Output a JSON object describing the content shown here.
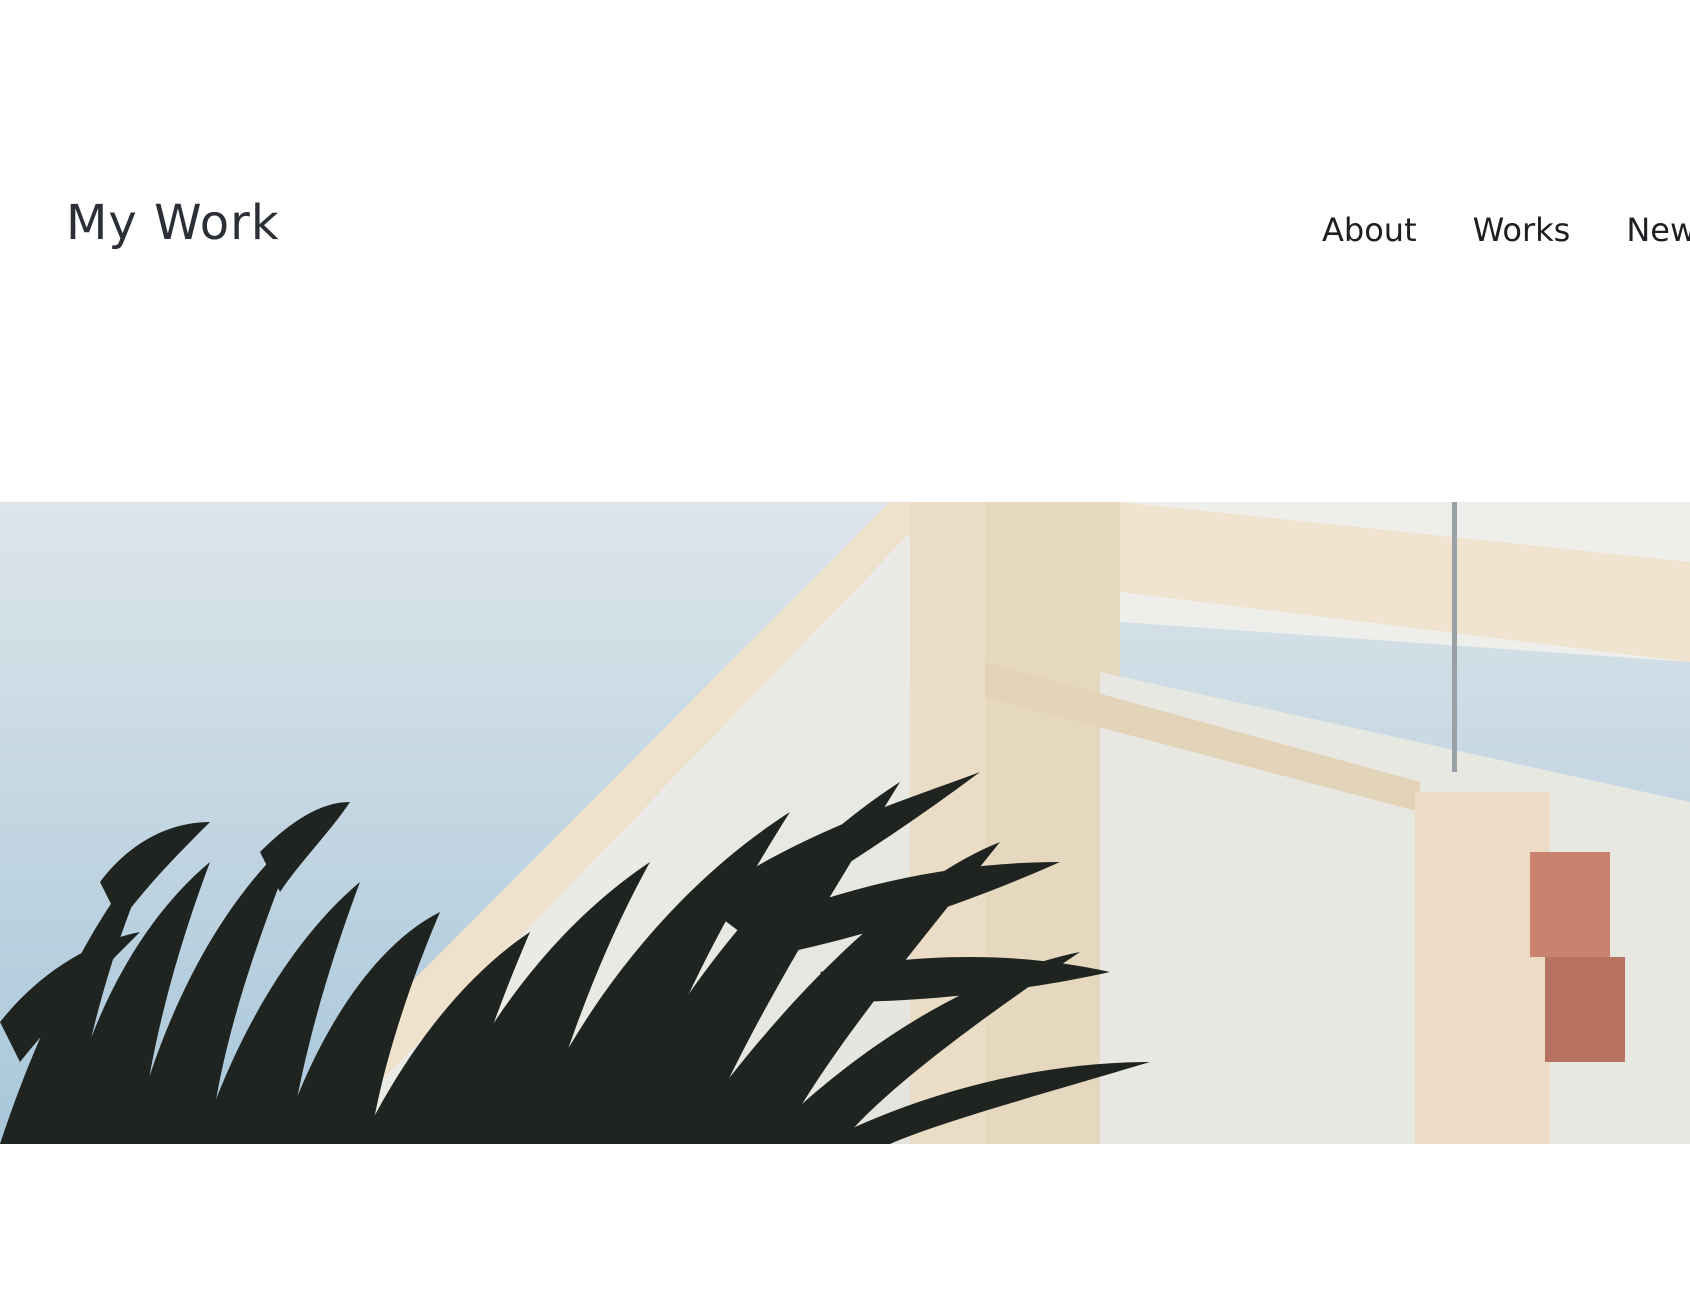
{
  "site": {
    "title": "My Work"
  },
  "nav": {
    "items": [
      {
        "label": "About"
      },
      {
        "label": "Works"
      },
      {
        "label": "New"
      }
    ]
  },
  "hero": {
    "image_subject": "palm-fronds-and-building-corner",
    "colors": {
      "sky_top": "#dde5ea",
      "sky_bottom": "#a8c7da",
      "building_trim": "#efe2cd",
      "building_wall": "#eeeeea",
      "palm": "#1f2420",
      "vent": "#c8826d"
    }
  }
}
